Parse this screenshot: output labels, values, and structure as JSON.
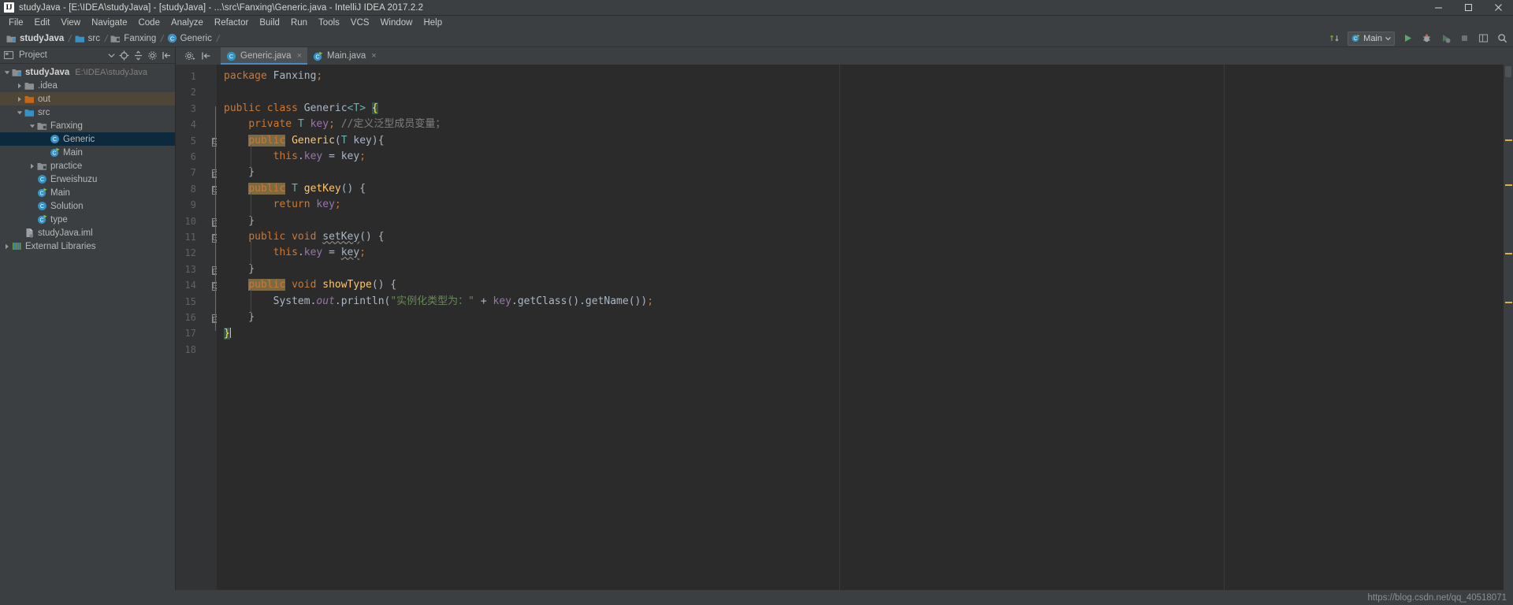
{
  "window": {
    "title": "studyJava - [E:\\IDEA\\studyJava] - [studyJava] - ...\\src\\Fanxing\\Generic.java - IntelliJ IDEA 2017.2.2",
    "logo_text": "IJ",
    "buttons": {
      "minimize": "minimize-icon",
      "maximize": "maximize-icon",
      "close": "close-icon"
    }
  },
  "menu": {
    "items": [
      "File",
      "Edit",
      "View",
      "Navigate",
      "Code",
      "Analyze",
      "Refactor",
      "Build",
      "Run",
      "Tools",
      "VCS",
      "Window",
      "Help"
    ]
  },
  "navbar": {
    "breadcrumbs": [
      {
        "label": "studyJava",
        "icon": "module-folder-icon",
        "bold": true
      },
      {
        "label": "src",
        "icon": "source-folder-icon",
        "bold": false
      },
      {
        "label": "Fanxing",
        "icon": "package-folder-icon",
        "bold": false
      },
      {
        "label": "Generic",
        "icon": "java-class-icon",
        "bold": false
      }
    ],
    "separator": "❯",
    "run_config": "Main",
    "right_icons": [
      "vcs-update-icon",
      "run-icon",
      "debug-icon",
      "coverage-icon",
      "stop-icon",
      "layout-icon",
      "search-everywhere-icon"
    ]
  },
  "project_panel": {
    "title": "Project",
    "header_icons": [
      "project-view-icon",
      "collapse-chevron-icon",
      "locate-icon",
      "collapse-all-icon",
      "settings-icon",
      "hide-icon"
    ],
    "tree": [
      {
        "label": "studyJava",
        "sub": "E:\\IDEA\\studyJava",
        "depth": 0,
        "arrow": "down",
        "icon": "module-icon",
        "state": "root"
      },
      {
        "label": ".idea",
        "sub": "",
        "depth": 1,
        "arrow": "right",
        "icon": "folder-grey-icon",
        "state": "normal"
      },
      {
        "label": "out",
        "sub": "",
        "depth": 1,
        "arrow": "right",
        "icon": "folder-orange-icon",
        "state": "highlighted"
      },
      {
        "label": "src",
        "sub": "",
        "depth": 1,
        "arrow": "down",
        "icon": "folder-source-icon",
        "state": "normal"
      },
      {
        "label": "Fanxing",
        "sub": "",
        "depth": 2,
        "arrow": "down",
        "icon": "package-icon",
        "state": "normal"
      },
      {
        "label": "Generic",
        "sub": "",
        "depth": 3,
        "arrow": "none",
        "icon": "java-class-icon",
        "state": "selected"
      },
      {
        "label": "Main",
        "sub": "",
        "depth": 3,
        "arrow": "none",
        "icon": "java-class-runnable-icon",
        "state": "normal"
      },
      {
        "label": "practice",
        "sub": "",
        "depth": 2,
        "arrow": "right",
        "icon": "package-icon",
        "state": "normal"
      },
      {
        "label": "Erweishuzu",
        "sub": "",
        "depth": 2,
        "arrow": "none",
        "icon": "java-class-icon",
        "state": "normal"
      },
      {
        "label": "Main",
        "sub": "",
        "depth": 2,
        "arrow": "none",
        "icon": "java-class-runnable-icon",
        "state": "normal"
      },
      {
        "label": "Solution",
        "sub": "",
        "depth": 2,
        "arrow": "none",
        "icon": "java-class-icon",
        "state": "normal"
      },
      {
        "label": "type",
        "sub": "",
        "depth": 2,
        "arrow": "none",
        "icon": "java-class-runnable-icon",
        "state": "normal"
      },
      {
        "label": "studyJava.iml",
        "sub": "",
        "depth": 1,
        "arrow": "none",
        "icon": "iml-file-icon",
        "state": "normal"
      },
      {
        "label": "External Libraries",
        "sub": "",
        "depth": 0,
        "arrow": "right",
        "icon": "libraries-icon",
        "state": "normal"
      }
    ]
  },
  "tabs": [
    {
      "label": "Generic.java",
      "icon": "java-class-icon",
      "active": true,
      "close": "×"
    },
    {
      "label": "Main.java",
      "icon": "java-class-runnable-icon",
      "active": false,
      "close": "×"
    }
  ],
  "editor": {
    "line_numbers": [
      "1",
      "2",
      "3",
      "4",
      "5",
      "6",
      "7",
      "8",
      "9",
      "10",
      "11",
      "12",
      "13",
      "14",
      "15",
      "16",
      "17",
      "18"
    ],
    "lines": [
      {
        "n": 1,
        "text": "package Fanxing;"
      },
      {
        "n": 2,
        "text": ""
      },
      {
        "n": 3,
        "text": "public class Generic<T> {"
      },
      {
        "n": 4,
        "text": "    private T key; //定义泛型成员变量；"
      },
      {
        "n": 5,
        "text": "    public Generic(T key){"
      },
      {
        "n": 6,
        "text": "        this.key = key;"
      },
      {
        "n": 7,
        "text": "    }"
      },
      {
        "n": 8,
        "text": "    public T getKey() {"
      },
      {
        "n": 9,
        "text": "        return key;"
      },
      {
        "n": 10,
        "text": "    }"
      },
      {
        "n": 11,
        "text": "    public void setKey() {"
      },
      {
        "n": 12,
        "text": "        this.key = key;"
      },
      {
        "n": 13,
        "text": "    }"
      },
      {
        "n": 14,
        "text": "    public void showType() {"
      },
      {
        "n": 15,
        "text": "        System.out.println(\"实例化类型为：\" + key.getClass().getName());"
      },
      {
        "n": 16,
        "text": "    }"
      },
      {
        "n": 17,
        "text": "}"
      },
      {
        "n": 18,
        "text": ""
      }
    ],
    "comment_text": "//定义泛型成员变量；",
    "string_literal": "\"实例化类型为：\"",
    "caret_line": 17,
    "fold_markers": [
      5,
      7,
      8,
      10,
      11,
      13,
      14,
      16
    ]
  },
  "markers": {
    "colors": [
      "#d9b24b",
      "#d9b24b",
      "#d9b24b",
      "#d9b24b"
    ]
  },
  "statusbar": {
    "watermark": "https://blog.csdn.net/qq_40518071"
  },
  "colors": {
    "background": "#3c3f41",
    "editor_background": "#2b2b2b",
    "gutter": "#313335",
    "selection": "#0d293e",
    "accent": "#4a88c7",
    "keyword": "#cc7832",
    "string": "#6a8759",
    "field": "#9876aa",
    "method": "#ffc66d",
    "comment": "#808080",
    "generic": "#6ab0b0",
    "highlight_keyword": "#7b6a44",
    "brace_match": "#3b514d"
  }
}
